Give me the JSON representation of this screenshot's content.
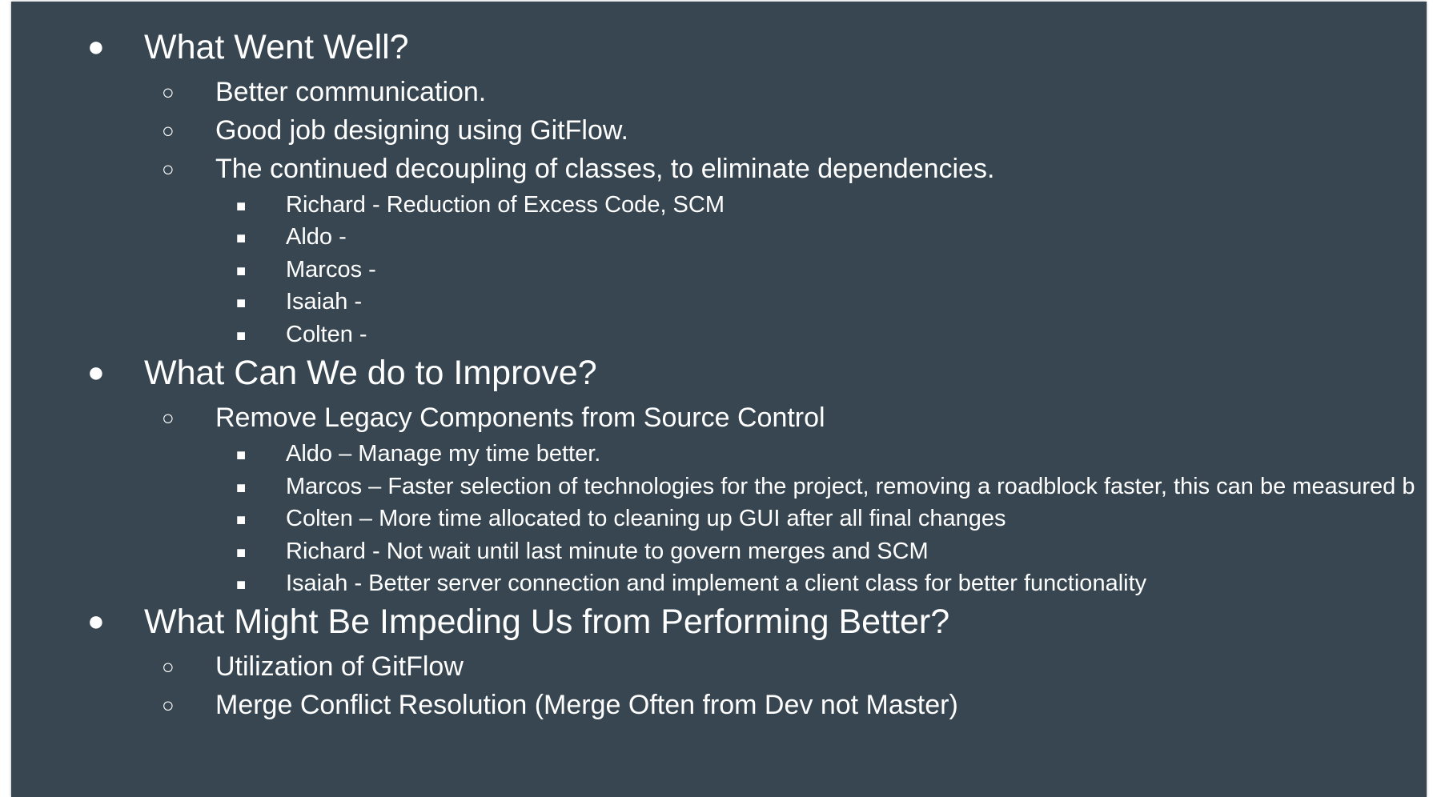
{
  "slide": {
    "background": "#374650",
    "text_color": "#ffffff",
    "bullet_glyphs": {
      "level1": "●",
      "level2": "○",
      "level3": "■"
    },
    "sections": [
      {
        "heading": "What Went Well?",
        "items": [
          {
            "text": "Better communication.",
            "subitems": []
          },
          {
            "text": "Good job designing using GitFlow.",
            "subitems": []
          },
          {
            "text": "The continued  decoupling of classes, to eliminate dependencies.",
            "subitems": [
              "Richard - Reduction of Excess Code, SCM",
              "Aldo -",
              "Marcos -",
              "Isaiah -",
              "Colten -"
            ]
          }
        ]
      },
      {
        "heading": "What Can We do to Improve?",
        "items": [
          {
            "text": "Remove Legacy Components from Source Control",
            "subitems": [
              "Aldo – Manage my time better.",
              "Marcos – Faster selection of technologies for the project, removing a roadblock faster, this can be measured b",
              "Colten – More time allocated to cleaning up GUI after all final changes",
              "Richard - Not wait until last minute to govern merges and SCM",
              "Isaiah -  Better server connection and implement a client class for better functionality"
            ]
          }
        ]
      },
      {
        "heading": "What Might Be Impeding Us from Performing Better?",
        "items": [
          {
            "text": "Utilization of GitFlow",
            "subitems": []
          },
          {
            "text": "Merge Conflict Resolution (Merge Often from Dev not Master)",
            "subitems": []
          }
        ]
      }
    ]
  }
}
